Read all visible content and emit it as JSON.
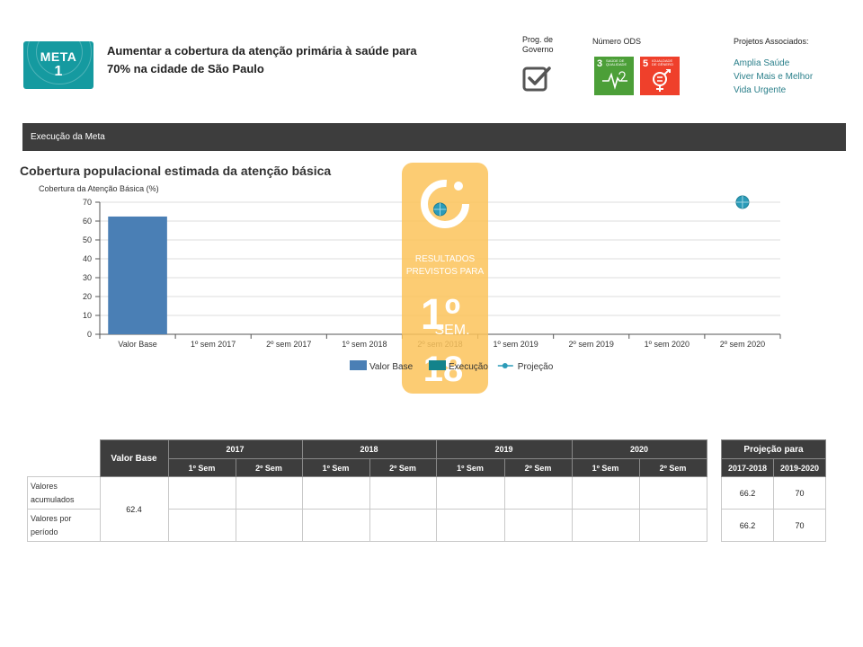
{
  "header": {
    "meta_word": "META",
    "meta_number": "1",
    "title": "Aumentar a cobertura da atenção primária à saúde para 70% na cidade de São Paulo",
    "prog_governo_label": "Prog. de Governo",
    "ods_label": "Número ODS",
    "ods": [
      {
        "number": "3",
        "text": "SAÚDE DE QUALIDADE",
        "color": "#4c9f38",
        "icon": "heartbeat-icon"
      },
      {
        "number": "5",
        "text": "IGUALDADE DE GÊNERO",
        "color": "#ef402b",
        "icon": "gender-equality-icon"
      }
    ],
    "projetos_label": "Projetos Associados:",
    "projetos": [
      "Amplia Saúde",
      "Viver Mais e Melhor",
      "Vida Urgente"
    ]
  },
  "section": {
    "title": "Execução da Meta"
  },
  "chart_title": "Cobertura populacional estimada da atenção básica",
  "watermark": {
    "line1": "RESULTADOS",
    "line2": "PREVISTOS PARA",
    "big": "1º",
    "sem": "SEM.",
    "year": "18"
  },
  "chart_data": {
    "type": "bar",
    "title": "Cobertura populacional estimada da atenção básica",
    "ylabel": "Cobertura da Atenção Básica (%)",
    "xlabel": "",
    "ylim": [
      0,
      70
    ],
    "yticks": [
      0,
      10,
      20,
      30,
      40,
      50,
      60,
      70
    ],
    "categories": [
      "Valor Base",
      "1º sem 2017",
      "2º sem 2017",
      "1º sem 2018",
      "2º sem 2018",
      "1º sem 2019",
      "2º sem 2019",
      "1º sem 2020",
      "2º sem 2020"
    ],
    "series": [
      {
        "name": "Valor Base",
        "kind": "bar",
        "color": "#4a7fb5",
        "values": [
          62.4,
          null,
          null,
          null,
          null,
          null,
          null,
          null,
          null
        ]
      },
      {
        "name": "Execução",
        "kind": "bar",
        "color": "#13838b",
        "values": [
          null,
          null,
          null,
          null,
          null,
          null,
          null,
          null,
          null
        ]
      },
      {
        "name": "Projeção",
        "kind": "point",
        "color": "#2b9bb8",
        "values": [
          null,
          null,
          null,
          null,
          66.2,
          null,
          null,
          null,
          70
        ]
      }
    ],
    "grid": true,
    "legend": "bottom-center"
  },
  "table": {
    "valor_base_header": "Valor Base",
    "years": [
      "2017",
      "2018",
      "2019",
      "2020"
    ],
    "sem_labels": [
      "1º Sem",
      "2º Sem"
    ],
    "rows": [
      {
        "label": "Valores acumulados",
        "cells": [
          "",
          "",
          "",
          "",
          "",
          "",
          "",
          ""
        ]
      },
      {
        "label": "Valores por período",
        "cells": [
          "",
          "",
          "",
          "",
          "",
          "",
          "",
          ""
        ]
      }
    ],
    "valor_base": "62.4"
  },
  "projection": {
    "header": "Projeção para",
    "periods": [
      "2017-2018",
      "2019-2020"
    ],
    "rows": [
      [
        "66.2",
        "70"
      ],
      [
        "66.2",
        "70"
      ]
    ]
  }
}
